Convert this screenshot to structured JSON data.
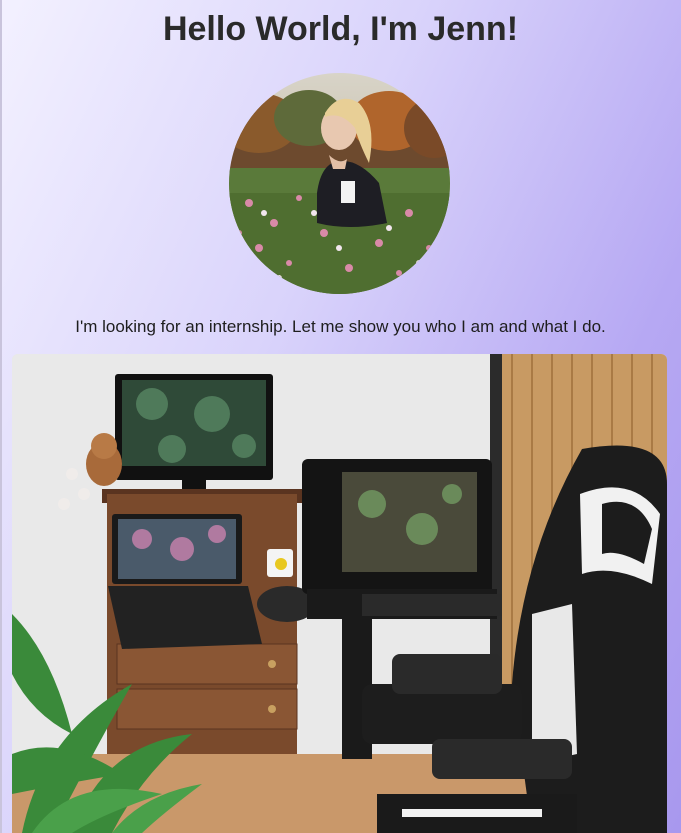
{
  "header": {
    "title": "Hello World, I'm Jenn!"
  },
  "intro": {
    "tagline": "I'm looking for an internship. Let me show you who I am and what I do."
  },
  "images": {
    "avatar": "profile-photo",
    "desk": "workspace-photo"
  },
  "colors": {
    "bg_start": "#f3f1ff",
    "bg_end": "#a898ee",
    "title": "#2a2a2a"
  }
}
